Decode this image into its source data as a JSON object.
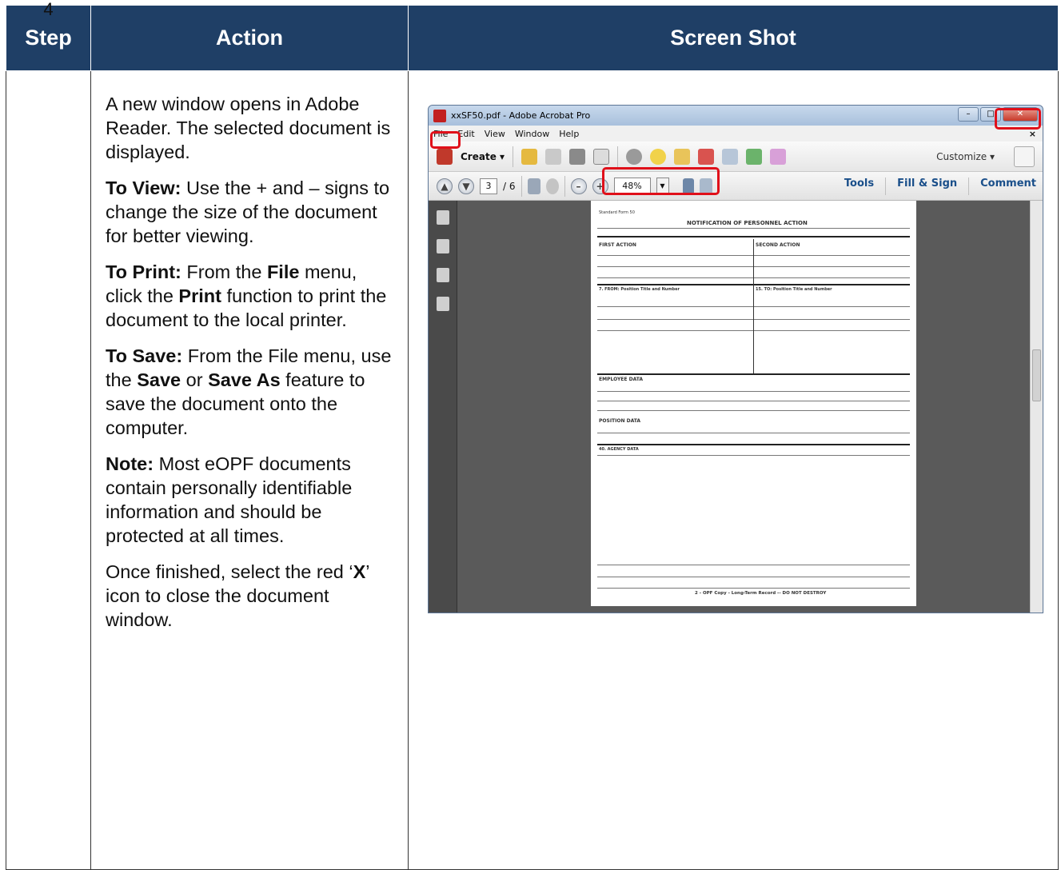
{
  "headers": {
    "step": "Step",
    "action": "Action",
    "screenshot": "Screen Shot"
  },
  "step_number": "4",
  "action": {
    "p1": "A new window opens in Adobe Reader. The selected document is displayed.",
    "view_label": "To View:",
    "view_text": " Use the + and – signs to change the size of the document for better viewing.",
    "print_label": "To Print:",
    "print_t1": " From the ",
    "print_file": "File",
    "print_t2": " menu, click the ",
    "print_print": "Print",
    "print_t3": " function to print the document to the local printer.",
    "save_label": "To Save:",
    "save_t1": " From the File menu, use the ",
    "save_save": "Save",
    "save_t2": " or ",
    "save_saveas": "Save As",
    "save_t3": " feature to save the document onto the computer.",
    "note_label": "Note:",
    "note_text": "  Most eOPF documents contain personally identifiable information and should be protected at all times.",
    "finish_t1": "Once finished, select the red ‘",
    "finish_x": "X",
    "finish_t2": "’ icon to close the document window."
  },
  "window": {
    "title": "xxSF50.pdf - Adobe Acrobat Pro",
    "menu": [
      "File",
      "Edit",
      "View",
      "Window",
      "Help"
    ],
    "close_menu": "×",
    "create": "Create ▾",
    "customize": "Customize ▾",
    "page_current": "3",
    "page_total": "/ 6",
    "zoom": "48%",
    "tools": [
      "Tools",
      "Fill & Sign",
      "Comment"
    ]
  },
  "document": {
    "header_left": "Standard Form 50",
    "title": "NOTIFICATION OF PERSONNEL ACTION",
    "first_action": "FIRST ACTION",
    "second_action": "SECOND ACTION",
    "from": "7. FROM: Position Title and Number",
    "to": "15. TO: Position Title and Number",
    "employee_data": "EMPLOYEE DATA",
    "position_data": "POSITION DATA",
    "agency_data": "40. AGENCY DATA",
    "footer": "2 - OPF Copy - Long-Term Record -- DO NOT DESTROY"
  },
  "colors": {
    "header_bg": "#1f3f66",
    "highlight": "#e0101a"
  }
}
